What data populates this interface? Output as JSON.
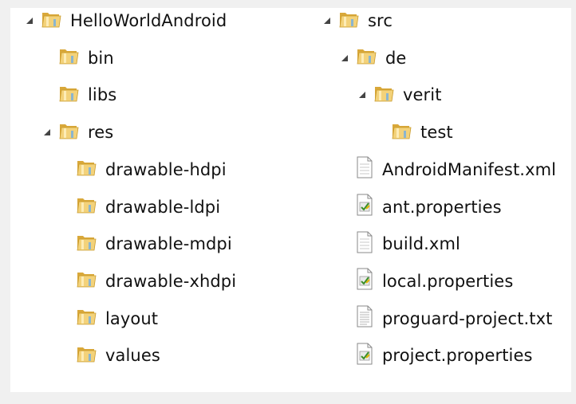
{
  "tree_left": {
    "nodes": [
      {
        "label": "HelloWorldAndroid",
        "icon": "folder-icon",
        "expanded": true
      },
      {
        "label": "bin",
        "icon": "folder-icon"
      },
      {
        "label": "libs",
        "icon": "folder-icon"
      },
      {
        "label": "res",
        "icon": "folder-icon",
        "expanded": true
      },
      {
        "label": "drawable-hdpi",
        "icon": "folder-icon"
      },
      {
        "label": "drawable-ldpi",
        "icon": "folder-icon"
      },
      {
        "label": "drawable-mdpi",
        "icon": "folder-icon"
      },
      {
        "label": "drawable-xhdpi",
        "icon": "folder-icon"
      },
      {
        "label": "layout",
        "icon": "folder-icon"
      },
      {
        "label": "values",
        "icon": "folder-icon"
      }
    ]
  },
  "tree_right": {
    "nodes": [
      {
        "label": "src",
        "icon": "folder-icon",
        "expanded": true
      },
      {
        "label": "de",
        "icon": "folder-icon",
        "expanded": true
      },
      {
        "label": "verit",
        "icon": "folder-icon",
        "expanded": true
      },
      {
        "label": "test",
        "icon": "folder-icon"
      },
      {
        "label": "AndroidManifest.xml",
        "icon": "document-icon"
      },
      {
        "label": "ant.properties",
        "icon": "properties-file-icon"
      },
      {
        "label": "build.xml",
        "icon": "document-icon"
      },
      {
        "label": "local.properties",
        "icon": "properties-file-icon"
      },
      {
        "label": "proguard-project.txt",
        "icon": "text-file-icon"
      },
      {
        "label": "project.properties",
        "icon": "properties-file-icon"
      }
    ]
  },
  "colors": {
    "panel_background": "#ffffff",
    "page_background": "#f0f0f0",
    "folder_tab": "#d9a83a",
    "folder_body": "#f3d27a",
    "expander_arrow": "#444444"
  }
}
